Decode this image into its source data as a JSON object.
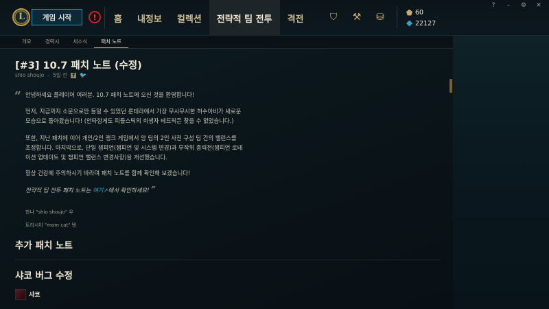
{
  "topbar": {
    "play_button": "게임 시작",
    "alert_symbol": "!",
    "nav": [
      "홈",
      "내정보",
      "컬렉션",
      "전략적 팀 전투",
      "격전"
    ],
    "active_nav": "전략적 팀 전투",
    "icons": [
      "tft-pass-icon",
      "crafting-icon",
      "store-icon"
    ],
    "currency": {
      "blue_essence": "60",
      "riot_points": "22127"
    },
    "window_controls": [
      "?",
      "–",
      "⚙",
      "✕"
    ]
  },
  "subnav": {
    "items": [
      "개요",
      "경력시",
      "새소식",
      "패치 노트"
    ],
    "active": "패치 노트"
  },
  "article": {
    "title": "[#3] 10.7 패치 노트 (수정)",
    "author": "shio shoujo",
    "time": "5일 전",
    "intro": "안녕하세요 플레이어 여러분. 10.7 패치 노트에 오신 것을 환영합니다!",
    "p1_line1": "먼저, 지금까지 소문으로만 들일 수 있었던 룬테라에서 가장 무시무시한 허수아비가 새로운",
    "p1_line2": "모습으로 돌아왔습니다! (안타깝게도 피들스틱의 희생자 테드릭은 찾을 수 없었습니다.)",
    "p2_line1": "또한, 지난 패치에 이어 개인/2인 랭크 게임에서 앙 팀의 2인 사전 구성 팀 간의 밸런스를",
    "p2_line2": "조정합니다. 마지막으로, 단일 챔피언(챔피언 및 시스템 변경)과 무작위 총력전(챔피언 로테",
    "p2_line3": "이션 업데이트 및 챔피언 밸런스 변경사항)을 개선했습니다.",
    "p3": "항상 건강에 주의하시기 바라며 패치 노트를 함께 확인해 보겠습니다!",
    "p4_before": "전략적 팀 전투 패치 노트는",
    "p4_link": "여기",
    "p4_arrow": "↗",
    "p4_after": "에서 확인하세요!",
    "quote_open": "“",
    "quote_close": "”",
    "signature1": "한나 \"shio shoujo\" 우",
    "signature2": "트리시아 \"mom cat\" 텐",
    "section1": "추가 패치 노트",
    "section2": "샤코 버그 수정",
    "champion": "샤코"
  }
}
